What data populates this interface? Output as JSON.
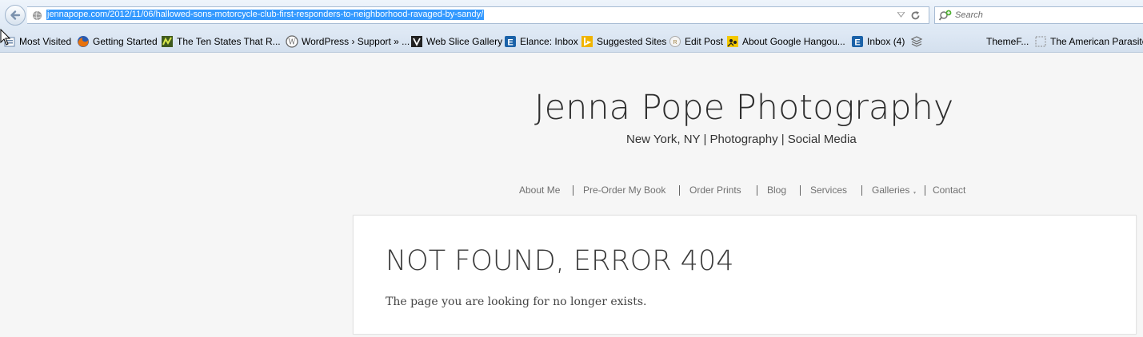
{
  "browser": {
    "url": "jennapope.com/2012/11/06/hallowed-sons-motorcycle-club-first-responders-to-neighborhood-ravaged-by-sandy/",
    "search_placeholder": "Search",
    "bookmarks": [
      {
        "label": "Most Visited",
        "icon": "most-visited-icon"
      },
      {
        "label": "Getting Started",
        "icon": "firefox-icon"
      },
      {
        "label": "The Ten States That R...",
        "icon": "site-favicon"
      },
      {
        "label": "WordPress › Support » ...",
        "icon": "wordpress-icon"
      },
      {
        "label": "Web Slice Gallery",
        "icon": "web-slice-icon"
      },
      {
        "label": "Elance: Inbox",
        "icon": "elance-icon"
      },
      {
        "label": "Suggested Sites",
        "icon": "bing-icon"
      },
      {
        "label": "Edit Post",
        "icon": "edit-post-icon"
      },
      {
        "label": "About Google Hangou...",
        "icon": "hangouts-icon"
      },
      {
        "label": "Inbox (4)",
        "icon": "elance-icon"
      },
      {
        "label": "",
        "icon": "layers-icon"
      },
      {
        "label": "ThemeF...",
        "icon": ""
      },
      {
        "label": "The American Parasite",
        "icon": "blank-page-icon"
      }
    ]
  },
  "site": {
    "title": "Jenna Pope Photography",
    "tagline": "New York, NY | Photography | Social Media",
    "nav": [
      "About Me",
      "Pre-Order My Book",
      "Order Prints",
      "Blog",
      "Services",
      "Galleries",
      "Contact"
    ],
    "galleries_caret": "▾"
  },
  "content": {
    "heading": "NOT FOUND, ERROR 404",
    "message": "The page you are looking for no longer exists."
  },
  "colors": {
    "page_bg": "#f6f6f6",
    "url_selection": "#3399ff",
    "nav_text": "#707070"
  }
}
